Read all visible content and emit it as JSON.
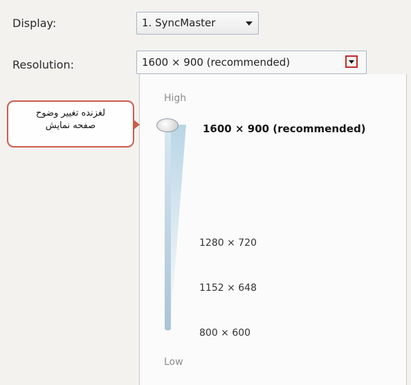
{
  "display": {
    "label": "Display:",
    "selected": "1. SyncMaster"
  },
  "resolution": {
    "label": "Resolution:",
    "selected": "1600 × 900 (recommended)"
  },
  "slider": {
    "high_label": "High",
    "low_label": "Low",
    "options": [
      "1600 × 900 (recommended)",
      "1280 × 720",
      "1152 × 648",
      "800 × 600"
    ]
  },
  "callout": {
    "line1": "لغزنده تغییر وضوح",
    "line2": "صفحه نمایش"
  }
}
